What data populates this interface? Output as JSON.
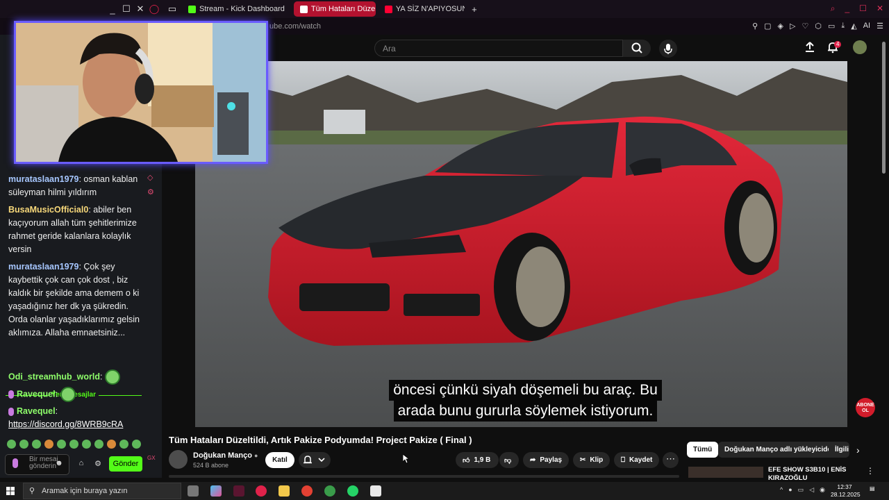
{
  "browser": {
    "tabs": [
      {
        "label": "Stream - Kick Dashboard",
        "icon": "kick-icon",
        "active": false
      },
      {
        "label": "Tüm Hataları Düzeltildi",
        "icon": "youtube-icon",
        "active": true
      },
      {
        "label": "YA SİZ N'APIYOSUNUZ! NE",
        "icon": "youtube-icon",
        "active": false
      }
    ],
    "new_tab": "+",
    "url": "ube.com/watch",
    "ai_label": "AI"
  },
  "chat": {
    "messages": [
      {
        "user": "murataslaan1979",
        "text": "osman kablan süleyman hilmi yıldırım",
        "color": "#a7c7ff"
      },
      {
        "user": "BusaMusicOfficial0",
        "text": "abiler ben kaçıyorum allah tüm şehitlerimize rahmet geride kalanlara kolaylık versin",
        "color": "#f7d87a"
      },
      {
        "user": "murataslaan1979",
        "text": "Çok şey kaybettik çok can çok dost , biz kaldık bir şekilde ama demem o ki yaşadığınız her dk ya şükredin. Orda olanlar yaşadıklarımız gelsin aklımıza. Allaha emnaetsiniz...",
        "color": "#a7c7ff"
      }
    ],
    "new_messages_label": "Yeni mesajlar",
    "new_messages": [
      {
        "user": "Odi_streamhub_world",
        "text": ""
      },
      {
        "user": "Ravequel",
        "text": ""
      },
      {
        "user": "Ravequel",
        "text": "https://discord.gg/8WRB9cRA"
      }
    ],
    "input_placeholder": "Bir mesaj gönderin",
    "send_label": "Gönder",
    "side_label": "GX"
  },
  "youtube": {
    "search_placeholder": "Ara",
    "notification_count": "4",
    "subtitle_lines": [
      "öncesi çünkü siyah döşemeli bu araç. Bu",
      "arada bunu gururla söylemek istiyorum."
    ],
    "abone_label": "ABONE OL",
    "video_title": "Tüm Hataları Düzeltildi, Artık Pakize Podyumda! Project Pakize ( Final )",
    "channel": {
      "name": "Doğukan Manço",
      "subscribers": "524 B abone"
    },
    "join_label": "Katıl",
    "actions": {
      "likes": "1,9 B",
      "share": "Paylaş",
      "clip": "Klip",
      "save": "Kaydet"
    },
    "chips": [
      "Tümü",
      "Doğukan Manço adlı yükleyiciden",
      "İlgili"
    ],
    "recommendation_title": "EFE SHOW S3B10 | ENİS KIRAZOĞLU"
  },
  "taskbar": {
    "search_placeholder": "Aramak için buraya yazın",
    "time": "12:37",
    "date": "28.12.2025"
  }
}
